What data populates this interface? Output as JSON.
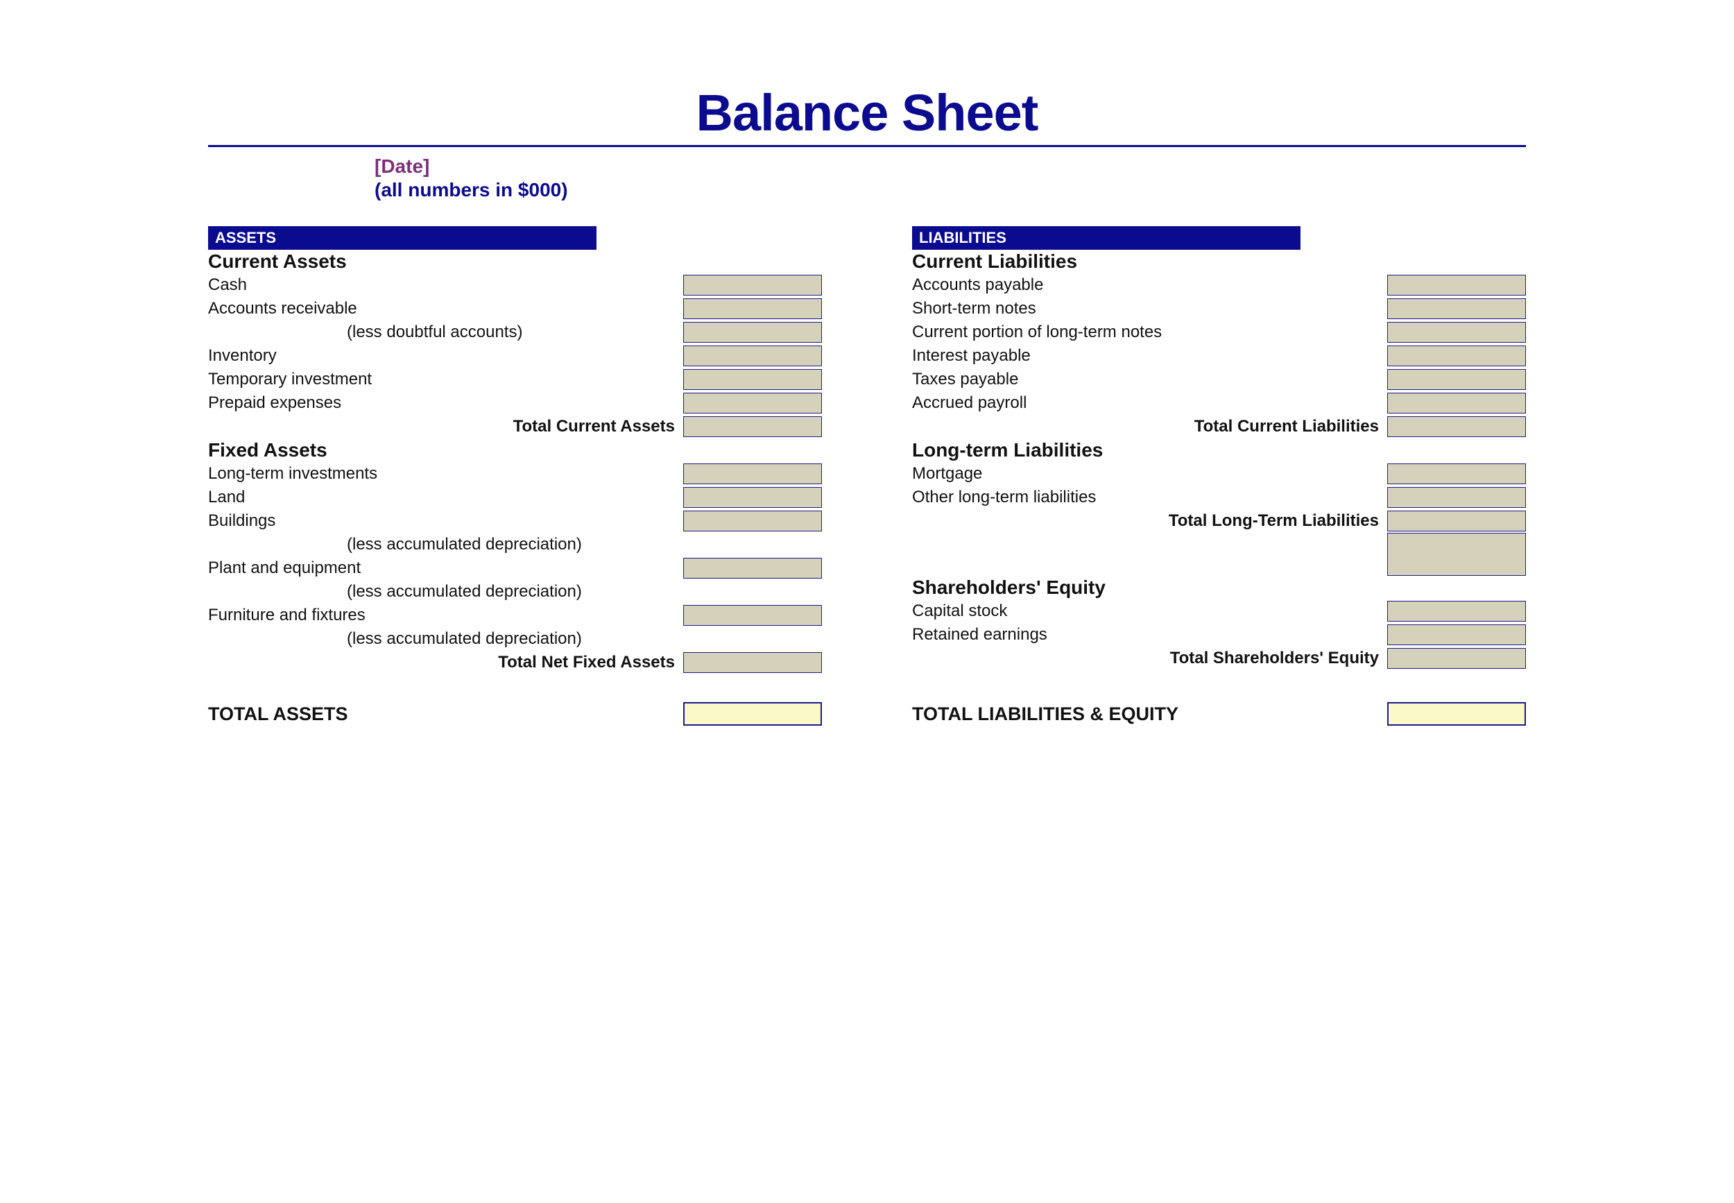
{
  "title": "Balance Sheet",
  "date_placeholder": "[Date]",
  "units_note": "(all numbers in $000)",
  "assets": {
    "header": "ASSETS",
    "current": {
      "title": "Current Assets",
      "items": [
        {
          "label": "Cash"
        },
        {
          "label": "Accounts receivable"
        },
        {
          "label": "(less doubtful accounts)",
          "indent": true
        },
        {
          "label": "Inventory"
        },
        {
          "label": "Temporary investment"
        },
        {
          "label": "Prepaid expenses"
        }
      ],
      "total_label": "Total Current Assets"
    },
    "fixed": {
      "title": "Fixed Assets",
      "items": [
        {
          "label": "Long-term investments"
        },
        {
          "label": "Land"
        },
        {
          "label": "Buildings"
        },
        {
          "label": "(less accumulated depreciation)",
          "indent": true,
          "nobox": true
        },
        {
          "label": "Plant and equipment"
        },
        {
          "label": "(less accumulated depreciation)",
          "indent": true,
          "nobox": true
        },
        {
          "label": "Furniture and fixtures"
        },
        {
          "label": "(less accumulated depreciation)",
          "indent": true,
          "nobox": true
        }
      ],
      "total_label": "Total Net Fixed Assets"
    },
    "grand_total_label": "TOTAL ASSETS"
  },
  "liabilities": {
    "header": "LIABILITIES",
    "current": {
      "title": "Current Liabilities",
      "items": [
        {
          "label": "Accounts payable"
        },
        {
          "label": "Short-term notes"
        },
        {
          "label": "Current portion of long-term notes"
        },
        {
          "label": "Interest payable"
        },
        {
          "label": "Taxes payable"
        },
        {
          "label": "Accrued payroll"
        }
      ],
      "total_label": "Total Current Liabilities"
    },
    "longterm": {
      "title": "Long-term Liabilities",
      "items": [
        {
          "label": "Mortgage"
        },
        {
          "label": "Other long-term liabilities"
        }
      ],
      "total_label": "Total Long-Term Liabilities"
    },
    "equity": {
      "title": "Shareholders' Equity",
      "items": [
        {
          "label": "Capital stock"
        },
        {
          "label": "Retained earnings"
        }
      ],
      "total_label": "Total Shareholders' Equity"
    },
    "grand_total_label": "TOTAL LIABILITIES & EQUITY"
  }
}
